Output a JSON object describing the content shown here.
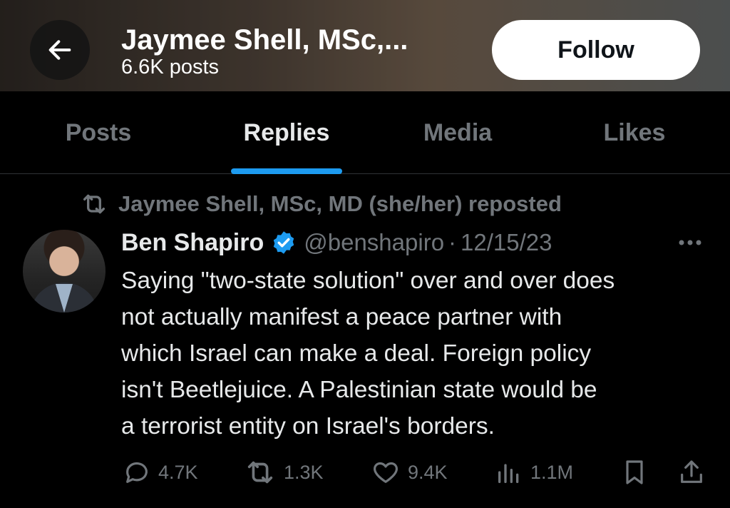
{
  "header": {
    "title": "Jaymee Shell, MSc,...",
    "subtitle": "6.6K posts",
    "follow_label": "Follow",
    "back_icon": "arrow-left-icon"
  },
  "tabs": [
    {
      "label": "Posts",
      "active": false
    },
    {
      "label": "Replies",
      "active": true
    },
    {
      "label": "Media",
      "active": false
    },
    {
      "label": "Likes",
      "active": false
    }
  ],
  "accent_color": "#1d9bf0",
  "post": {
    "repost_text": "Jaymee Shell, MSc, MD (she/her) reposted",
    "author": "Ben Shapiro",
    "handle": "@benshapiro",
    "separator": "·",
    "date": "12/15/23",
    "text_lines": [
      "Saying \"two-state solution\" over and over does",
      "not actually manifest a peace partner with",
      "which Israel can make a deal. Foreign policy",
      "isn't Beetlejuice. A Palestinian state would be",
      "a terrorist entity on Israel's borders."
    ],
    "metrics": {
      "replies": "4.7K",
      "reposts": "1.3K",
      "likes": "9.4K",
      "views": "1.1M"
    }
  }
}
